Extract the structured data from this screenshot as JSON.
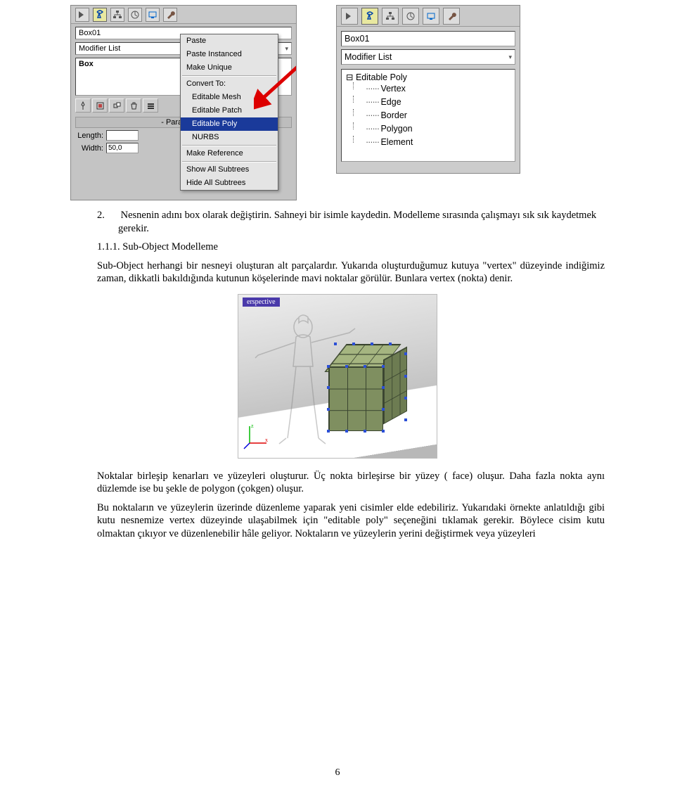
{
  "left_panel": {
    "obj_name": "Box01",
    "modifier_list_label": "Modifier List",
    "stack_item": "Box",
    "rollout_title": "Parameters",
    "length_label": "Length:",
    "width_label": "Width:",
    "width_val": "50,0"
  },
  "context_menu": {
    "items_top": [
      "Paste",
      "Paste Instanced",
      "Make Unique"
    ],
    "convert_label": "Convert To:",
    "convert_items": [
      "Editable Mesh",
      "Editable Patch",
      "Editable Poly",
      "NURBS"
    ],
    "highlighted": "Editable Poly",
    "make_ref": "Make Reference",
    "show_all": "Show All Subtrees",
    "hide_all": "Hide All Subtrees"
  },
  "right_panel": {
    "obj_name": "Box01",
    "modifier_list_label": "Modifier List",
    "stack_main": "⊟ Editable Poly",
    "sub_items": [
      "Vertex",
      "Edge",
      "Border",
      "Polygon",
      "Element"
    ]
  },
  "text": {
    "item2_num": "2.",
    "item2": "Nesnenin adını box olarak değiştirin. Sahneyi bir isimle kaydedin. Modelleme sırasında çalışmayı sık sık kaydetmek gerekir.",
    "sec_num": "1.1.1. Sub-Object Modelleme",
    "sec_body": "Sub-Object herhangi bir nesneyi oluşturan alt parçalardır. Yukarıda oluşturduğumuz kutuya \"vertex\" düzeyinde indiğimiz zaman, dikkatli bakıldığında kutunun köşelerinde mavi noktalar görülür. Bunlara vertex (nokta) denir.",
    "below1": "Noktalar birleşip kenarları ve yüzeyleri oluşturur. Üç nokta birleşirse bir yüzey ( face) oluşur. Daha fazla nokta aynı düzlemde ise bu şekle de polygon (çokgen) oluşur.",
    "below2": "Bu noktaların ve yüzeylerin üzerinde düzenleme yaparak yeni cisimler elde edebiliriz. Yukarıdaki örnekte anlatıldığı gibi kutu nesnemize vertex düzeyinde ulaşabilmek için \"editable poly\" seçeneğini tıklamak gerekir. Böylece cisim kutu olmaktan çıkıyor ve düzenlenebilir hâle geliyor. Noktaların ve yüzeylerin yerini değiştirmek veya yüzeyleri"
  },
  "viewport_label": "erspective",
  "page_number": "6"
}
